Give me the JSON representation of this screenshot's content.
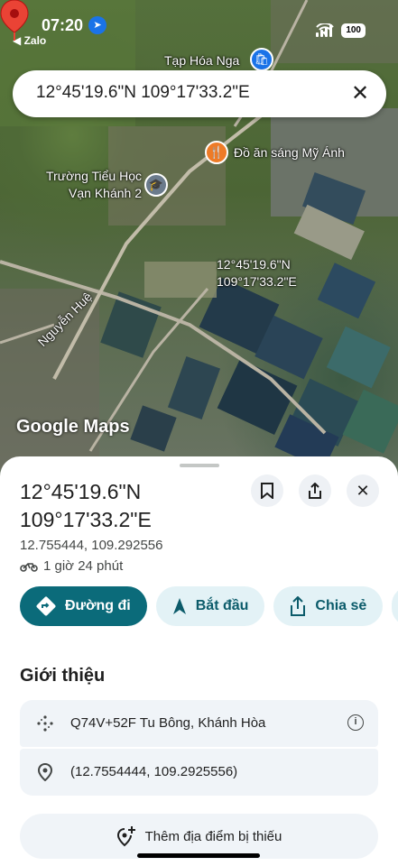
{
  "status": {
    "time": "07:20",
    "back_app": "◀ Zalo",
    "battery": "100"
  },
  "map": {
    "labels": {
      "tap_hoa": "Tạp Hóa Nga",
      "do_an": "Đồ ăn sáng Mỹ Ánh",
      "school_line1": "Trường Tiểu Học",
      "school_line2": "Vạn Khánh 2",
      "pin_line1": "12°45'19.6\"N",
      "pin_line2": "109°17'33.2\"E",
      "street": "Nguyễn Huệ"
    },
    "watermark": "Google Maps"
  },
  "search": {
    "value": "12°45'19.6\"N 109°17'33.2\"E"
  },
  "sheet": {
    "title_line1": "12°45'19.6\"N",
    "title_line2": "109°17'33.2\"E",
    "decimal_coords": "12.755444, 109.292556",
    "eta": "1 giờ 24 phút",
    "actions": {
      "directions": "Đường đi",
      "start": "Bắt đầu",
      "share": "Chia sẻ"
    },
    "section_title": "Giới thiệu",
    "plus_code": "Q74V+52F Tu Bông, Khánh Hòa",
    "precise_coords": "(12.7554444, 109.2925556)",
    "add_missing": "Thêm địa điểm bị thiếu"
  }
}
